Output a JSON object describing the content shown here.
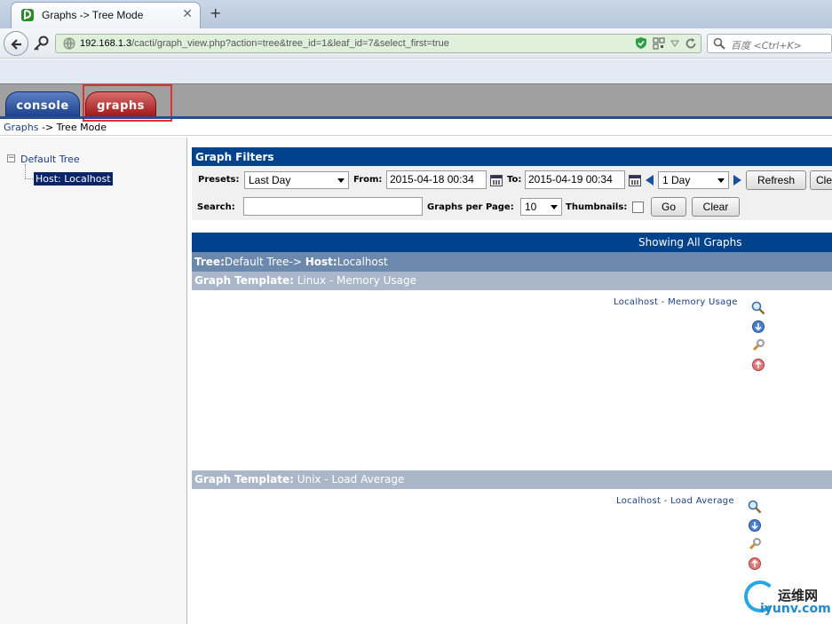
{
  "browser": {
    "tab_title": "Graphs -> Tree Mode",
    "new_tab": "+",
    "url_host": "192.168.1.3",
    "url_path": "/cacti/graph_view.php?action=tree&tree_id=1&leaf_id=7&select_first=true",
    "search_placeholder": "百度 <Ctrl+K>"
  },
  "cacti": {
    "tabs": {
      "console": "console",
      "graphs": "graphs"
    },
    "breadcrumb": {
      "link": "Graphs",
      "rest": " -> Tree Mode"
    }
  },
  "tree": {
    "toggle": "−",
    "root": "Default Tree",
    "leaf": "Host: Localhost"
  },
  "filters": {
    "title": "Graph Filters",
    "presets_label": "Presets:",
    "presets_value": "Last Day",
    "from_label": "From:",
    "from_value": "2015-04-18 00:34",
    "to_label": "To:",
    "to_value": "2015-04-19 00:34",
    "span_value": "1 Day",
    "refresh": "Refresh",
    "clear_cut": "Cle",
    "search_label": "Search:",
    "search_value": "",
    "per_page_label": "Graphs per Page:",
    "per_page_value": "10",
    "thumbnails_label": "Thumbnails:",
    "go": "Go",
    "clear": "Clear"
  },
  "listing": {
    "showing": "Showing All Graphs",
    "tree_key": "Tree:",
    "tree_val": "Default Tree-> ",
    "host_key": "Host:",
    "host_val": "Localhost",
    "templates": [
      {
        "key": "Graph Template:",
        "name": " Linux - Memory Usage",
        "graph": "Localhost - Memory Usage"
      },
      {
        "key": "Graph Template:",
        "name": " Unix - Load Average",
        "graph": "Localhost - Load Average"
      }
    ]
  },
  "watermark": {
    "cn": "运维网",
    "en": "iyunv.com"
  }
}
